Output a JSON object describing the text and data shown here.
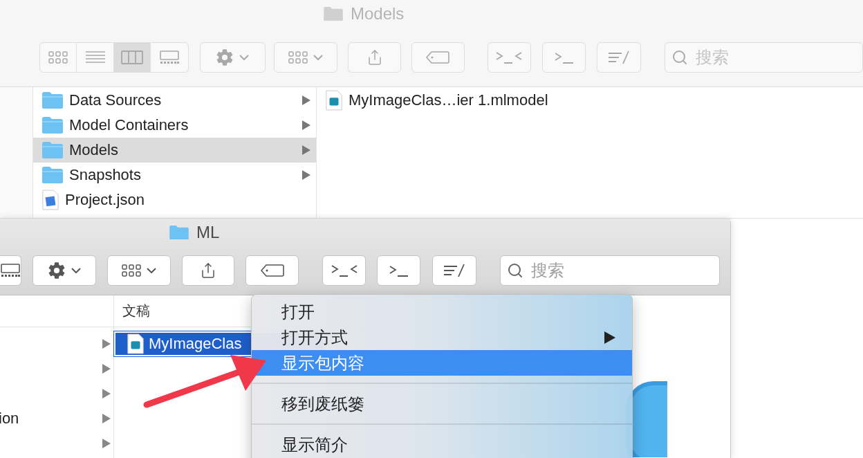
{
  "back_window": {
    "title": "Models",
    "toolbar": {
      "view_buttons": [
        {
          "kind": "icons",
          "selected": false
        },
        {
          "kind": "list",
          "selected": false
        },
        {
          "kind": "columns",
          "selected": true
        },
        {
          "kind": "gallery",
          "selected": false
        }
      ],
      "search": {
        "placeholder": "搜索"
      }
    },
    "columns": [
      {
        "items": [
          {
            "name": "Data Sources",
            "kind": "folder",
            "selected": false,
            "has_children": true
          },
          {
            "name": "Model Containers",
            "kind": "folder",
            "selected": false,
            "has_children": true
          },
          {
            "name": "Models",
            "kind": "folder",
            "selected": true,
            "has_children": true
          },
          {
            "name": "Snapshots",
            "kind": "folder",
            "selected": false,
            "has_children": true
          },
          {
            "name": "Project.json",
            "kind": "json",
            "selected": false,
            "has_children": false
          }
        ]
      },
      {
        "items": [
          {
            "name": "MyImageClas…ier 1.mlmodel",
            "kind": "mlmodel",
            "selected": false,
            "has_children": false
          }
        ]
      }
    ]
  },
  "front_window": {
    "title": "ML",
    "toolbar": {
      "view_buttons": [
        {
          "kind": "gallery",
          "selected": false
        }
      ],
      "search": {
        "placeholder": "搜索"
      }
    },
    "columns": [
      {
        "items": [
          {
            "has_children": true
          },
          {
            "has_children": true
          },
          {
            "has_children": true
          },
          {
            "name": "ion",
            "has_children": true
          },
          {
            "has_children": true
          }
        ]
      },
      {
        "header": "文稿",
        "items": [
          {
            "name": "MyImageClas",
            "kind": "mlmodel",
            "selected": true
          }
        ]
      }
    ]
  },
  "context_menu": {
    "items": [
      {
        "kind": "item",
        "label": "打开",
        "selected": false,
        "submenu": false
      },
      {
        "kind": "item",
        "label": "打开方式",
        "selected": false,
        "submenu": true
      },
      {
        "kind": "item",
        "label": "显示包内容",
        "selected": true,
        "submenu": false
      },
      {
        "kind": "separator"
      },
      {
        "kind": "item",
        "label": "移到废纸篓",
        "selected": false,
        "submenu": false
      },
      {
        "kind": "separator"
      },
      {
        "kind": "item",
        "label": "显示简介",
        "selected": false,
        "submenu": false
      }
    ]
  }
}
